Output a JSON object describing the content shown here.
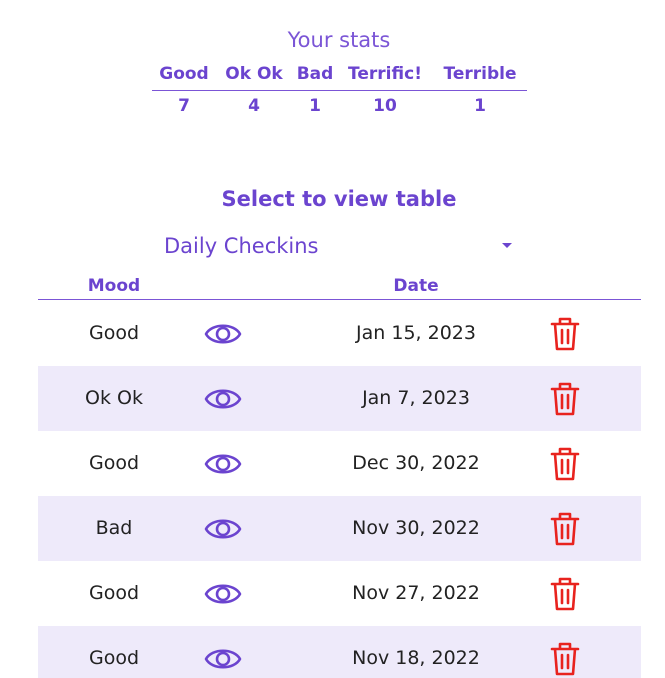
{
  "stats": {
    "title": "Your stats",
    "headers": [
      "Good",
      "Ok Ok",
      "Bad",
      "Terrific!",
      "Terrible"
    ],
    "values": [
      "7",
      "4",
      "1",
      "10",
      "1"
    ]
  },
  "select": {
    "heading": "Select to view table",
    "value": "Daily Checkins",
    "caret_icon": "caret-down-icon"
  },
  "table": {
    "headers": {
      "mood": "Mood",
      "date": "Date"
    },
    "rows": [
      {
        "mood": "Good",
        "date": "Jan 15, 2023"
      },
      {
        "mood": "Ok Ok",
        "date": "Jan 7, 2023"
      },
      {
        "mood": "Good",
        "date": "Dec 30, 2022"
      },
      {
        "mood": "Bad",
        "date": "Nov 30, 2022"
      },
      {
        "mood": "Good",
        "date": "Nov 27, 2022"
      },
      {
        "mood": "Good",
        "date": "Nov 18, 2022"
      }
    ],
    "view_icon": "eye-icon",
    "delete_icon": "trash-icon"
  },
  "colors": {
    "accent": "#6b44cf",
    "row_alt": "#eeeafa",
    "delete": "#e8231e"
  }
}
